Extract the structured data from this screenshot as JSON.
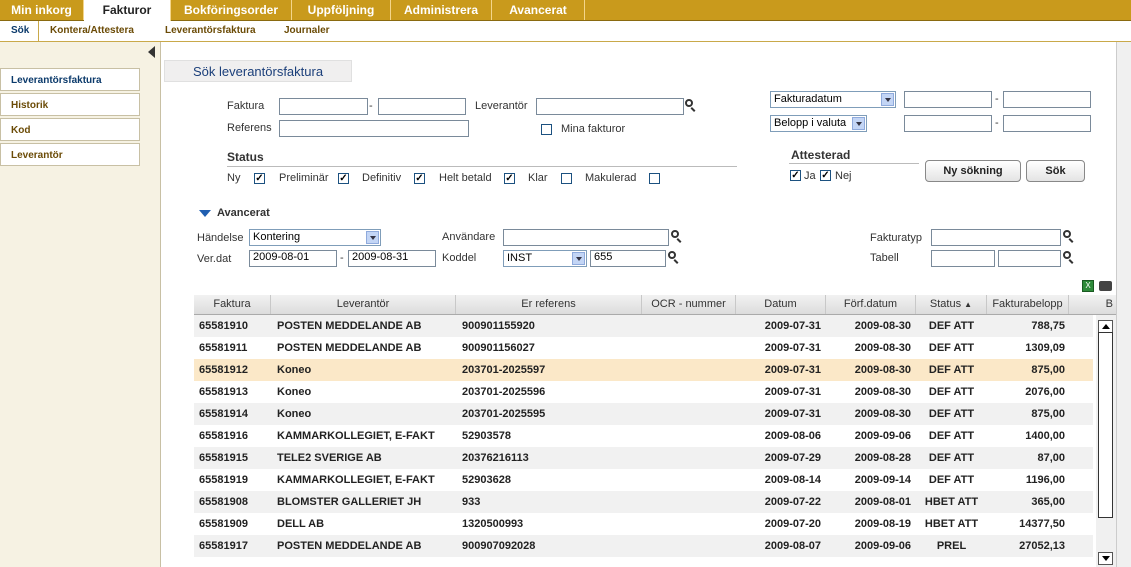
{
  "top_tabs": [
    "Min inkorg",
    "Fakturor",
    "Bokföringsorder",
    "Uppföljning",
    "Administrera",
    "Avancerat"
  ],
  "sub_tabs": [
    "Sök",
    "Kontera/Attestera",
    "Leverantörsfaktura",
    "Journaler"
  ],
  "sidebar": {
    "items": [
      "Leverantörsfaktura",
      "Historik",
      "Kod",
      "Leverantör"
    ]
  },
  "page_title": "Sök leverantörsfaktura",
  "search": {
    "faktura_label": "Faktura",
    "dash": "-",
    "leverantor_label": "Leverantör",
    "referens_label": "Referens",
    "mina_fakturor_label": "Mina fakturor",
    "date_select": "Fakturadatum",
    "amount_select": "Belopp i valuta",
    "new_search_button": "Ny sökning",
    "search_button": "Sök"
  },
  "status": {
    "title": "Status",
    "options": [
      {
        "label": "Ny",
        "checked": true
      },
      {
        "label": "Preliminär",
        "checked": true
      },
      {
        "label": "Definitiv",
        "checked": true
      },
      {
        "label": "Helt betald",
        "checked": true
      },
      {
        "label": "Klar",
        "checked": false
      },
      {
        "label": "Makulerad",
        "checked": false
      }
    ]
  },
  "attesterad": {
    "title": "Attesterad",
    "options": [
      {
        "label": "Ja",
        "checked": true
      },
      {
        "label": "Nej",
        "checked": true
      }
    ]
  },
  "advanced": {
    "title": "Avancerat",
    "handelse_label": "Händelse",
    "handelse_value": "Kontering",
    "verdat_label": "Ver.dat",
    "verdat_from": "2009-08-01",
    "verdat_to": "2009-08-31",
    "anvandare_label": "Användare",
    "koddel_label": "Koddel",
    "koddel_select": "INST",
    "koddel_value": "655",
    "fakturatyp_label": "Fakturatyp",
    "tabell_label": "Tabell"
  },
  "grid": {
    "columns": [
      "Faktura",
      "Leverantör",
      "Er referens",
      "OCR - nummer",
      "Datum",
      "Förf.datum",
      "Status",
      "Fakturabelopp",
      "B"
    ],
    "sort_indicator": "▲",
    "rows": [
      [
        "65581910",
        "POSTEN MEDDELANDE AB",
        "900901155920",
        "",
        "2009-07-31",
        "2009-08-30",
        "DEF ATT",
        "788,75"
      ],
      [
        "65581911",
        "POSTEN MEDDELANDE AB",
        "900901156027",
        "",
        "2009-07-31",
        "2009-08-30",
        "DEF ATT",
        "1309,09"
      ],
      [
        "65581912",
        "Koneo",
        "203701-2025597",
        "",
        "2009-07-31",
        "2009-08-30",
        "DEF ATT",
        "875,00"
      ],
      [
        "65581913",
        "Koneo",
        "203701-2025596",
        "",
        "2009-07-31",
        "2009-08-30",
        "DEF ATT",
        "2076,00"
      ],
      [
        "65581914",
        "Koneo",
        "203701-2025595",
        "",
        "2009-07-31",
        "2009-08-30",
        "DEF ATT",
        "875,00"
      ],
      [
        "65581916",
        "KAMMARKOLLEGIET, E-FAKT",
        "52903578",
        "",
        "2009-08-06",
        "2009-09-06",
        "DEF ATT",
        "1400,00"
      ],
      [
        "65581915",
        "TELE2 SVERIGE AB",
        "20376216113",
        "",
        "2009-07-29",
        "2009-08-28",
        "DEF ATT",
        "87,00"
      ],
      [
        "65581919",
        "KAMMARKOLLEGIET, E-FAKT",
        "52903628",
        "",
        "2009-08-14",
        "2009-09-14",
        "DEF ATT",
        "1196,00"
      ],
      [
        "65581908",
        "BLOMSTER GALLERIET JH",
        "933",
        "",
        "2009-07-22",
        "2009-08-01",
        "HBET ATT",
        "365,00"
      ],
      [
        "65581909",
        "DELL AB",
        "1320500993",
        "",
        "2009-07-20",
        "2009-08-19",
        "HBET ATT",
        "14377,50"
      ],
      [
        "65581917",
        "POSTEN MEDDELANDE AB",
        "900907092028",
        "",
        "2009-08-07",
        "2009-09-06",
        "PREL",
        "27052,13"
      ]
    ],
    "selected_row": 2
  },
  "colors": {
    "top_bar": "#c99a1c",
    "selected_row": "#fbe8c8",
    "accent_blue": "#1b3f7a"
  }
}
